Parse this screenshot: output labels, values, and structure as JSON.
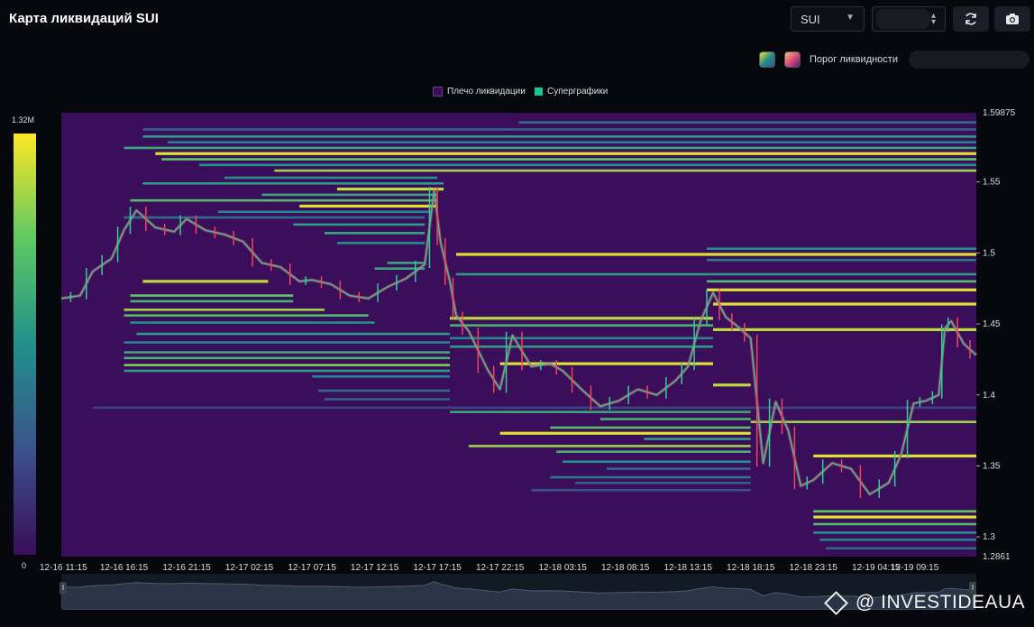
{
  "header": {
    "title": "Карта ликвидаций SUI",
    "symbol_select": "SUI",
    "range_select": "",
    "refresh_icon": "refresh-icon",
    "screenshot_icon": "camera-icon"
  },
  "threshold": {
    "label": "Порог ликвидности",
    "swatch_colors": [
      "#21918c",
      "#d94f7a"
    ]
  },
  "legend": {
    "items": [
      {
        "label": "Плечо ликвидации",
        "color": "#3a0e5a"
      },
      {
        "label": "Суперграфики",
        "color": "#18c88a"
      }
    ]
  },
  "colorbar": {
    "max_label": "1.32M",
    "min_label": "0",
    "colors": [
      "#3a0e5a",
      "#3b528b",
      "#21918c",
      "#5ec962",
      "#fde725"
    ]
  },
  "watermark": "@ INVESTIDEAUA",
  "chart_data": {
    "type": "heatmap",
    "title": "",
    "x_ticks": [
      "12-16 11:15",
      "12-16 16:15",
      "12-16 21:15",
      "12-17 02:15",
      "12-17 07:15",
      "12-17 12:15",
      "12-17 17:15",
      "12-17 22:15",
      "12-18 03:15",
      "12-18 08:15",
      "12-18 13:15",
      "12-18 18:15",
      "12-18 23:15",
      "12-19 04:15",
      "12-19 09:15"
    ],
    "y_ticks": [
      1.3,
      1.35,
      1.4,
      1.45,
      1.5,
      1.55
    ],
    "y_top_label": "1.59875",
    "y_bottom_label": "1.2861",
    "ylim": [
      1.2861,
      1.59875
    ],
    "xlim": [
      0,
      14.6
    ],
    "background_color": "#3a0e5a",
    "bands": [
      {
        "y": 1.592,
        "x0": 7.3,
        "x1": 14.6,
        "v": 0.35
      },
      {
        "y": 1.587,
        "x0": 1.3,
        "x1": 14.6,
        "v": 0.3
      },
      {
        "y": 1.582,
        "x0": 1.3,
        "x1": 14.6,
        "v": 0.55
      },
      {
        "y": 1.578,
        "x0": 1.7,
        "x1": 14.6,
        "v": 0.45
      },
      {
        "y": 1.574,
        "x0": 1.0,
        "x1": 14.6,
        "v": 0.6
      },
      {
        "y": 1.57,
        "x0": 1.5,
        "x1": 14.6,
        "v": 0.95
      },
      {
        "y": 1.566,
        "x0": 1.6,
        "x1": 14.6,
        "v": 0.75
      },
      {
        "y": 1.562,
        "x0": 2.2,
        "x1": 14.6,
        "v": 0.5
      },
      {
        "y": 1.558,
        "x0": 3.4,
        "x1": 14.6,
        "v": 0.85
      },
      {
        "y": 1.553,
        "x0": 2.6,
        "x1": 6.0,
        "v": 0.5
      },
      {
        "y": 1.549,
        "x0": 1.3,
        "x1": 6.1,
        "v": 0.55
      },
      {
        "y": 1.545,
        "x0": 4.4,
        "x1": 6.1,
        "v": 0.9
      },
      {
        "y": 1.541,
        "x0": 3.2,
        "x1": 6.0,
        "v": 0.6
      },
      {
        "y": 1.537,
        "x0": 1.1,
        "x1": 6.0,
        "v": 0.7
      },
      {
        "y": 1.533,
        "x0": 3.8,
        "x1": 6.0,
        "v": 0.95
      },
      {
        "y": 1.529,
        "x0": 2.5,
        "x1": 5.9,
        "v": 0.45
      },
      {
        "y": 1.525,
        "x0": 1.0,
        "x1": 5.8,
        "v": 0.35
      },
      {
        "y": 1.52,
        "x0": 3.7,
        "x1": 5.8,
        "v": 0.55
      },
      {
        "y": 1.514,
        "x0": 4.2,
        "x1": 5.8,
        "v": 0.6
      },
      {
        "y": 1.507,
        "x0": 4.4,
        "x1": 5.8,
        "v": 0.5
      },
      {
        "y": 1.503,
        "x0": 10.3,
        "x1": 14.6,
        "v": 0.5
      },
      {
        "y": 1.499,
        "x0": 6.3,
        "x1": 14.6,
        "v": 0.95
      },
      {
        "y": 1.495,
        "x0": 10.3,
        "x1": 14.6,
        "v": 0.4
      },
      {
        "y": 1.493,
        "x0": 5.2,
        "x1": 5.8,
        "v": 0.6
      },
      {
        "y": 1.489,
        "x0": 5.0,
        "x1": 5.8,
        "v": 0.6
      },
      {
        "y": 1.485,
        "x0": 6.3,
        "x1": 14.6,
        "v": 0.55
      },
      {
        "y": 1.48,
        "x0": 1.3,
        "x1": 3.3,
        "v": 0.9
      },
      {
        "y": 1.48,
        "x0": 10.3,
        "x1": 14.6,
        "v": 0.7
      },
      {
        "y": 1.474,
        "x0": 10.3,
        "x1": 14.6,
        "v": 0.95
      },
      {
        "y": 1.47,
        "x0": 1.1,
        "x1": 3.7,
        "v": 0.75
      },
      {
        "y": 1.466,
        "x0": 1.1,
        "x1": 3.7,
        "v": 0.65
      },
      {
        "y": 1.464,
        "x0": 10.4,
        "x1": 14.6,
        "v": 0.95
      },
      {
        "y": 1.46,
        "x0": 1.0,
        "x1": 4.2,
        "v": 0.85
      },
      {
        "y": 1.456,
        "x0": 1.0,
        "x1": 4.9,
        "v": 0.7
      },
      {
        "y": 1.454,
        "x0": 6.2,
        "x1": 10.4,
        "v": 0.9
      },
      {
        "y": 1.451,
        "x0": 1.1,
        "x1": 5.0,
        "v": 0.5
      },
      {
        "y": 1.449,
        "x0": 6.2,
        "x1": 10.4,
        "v": 0.65
      },
      {
        "y": 1.446,
        "x0": 10.4,
        "x1": 14.6,
        "v": 0.9
      },
      {
        "y": 1.443,
        "x0": 1.2,
        "x1": 6.2,
        "v": 0.55
      },
      {
        "y": 1.44,
        "x0": 6.2,
        "x1": 10.4,
        "v": 0.45
      },
      {
        "y": 1.437,
        "x0": 1.0,
        "x1": 6.2,
        "v": 0.45
      },
      {
        "y": 1.434,
        "x0": 6.2,
        "x1": 10.4,
        "v": 0.55
      },
      {
        "y": 1.43,
        "x0": 1.0,
        "x1": 6.2,
        "v": 0.6
      },
      {
        "y": 1.426,
        "x0": 1.0,
        "x1": 6.2,
        "v": 0.65
      },
      {
        "y": 1.422,
        "x0": 7.0,
        "x1": 10.4,
        "v": 0.95
      },
      {
        "y": 1.421,
        "x0": 1.0,
        "x1": 6.2,
        "v": 0.8
      },
      {
        "y": 1.417,
        "x0": 1.0,
        "x1": 6.2,
        "v": 0.55
      },
      {
        "y": 1.413,
        "x0": 4.0,
        "x1": 6.2,
        "v": 0.45
      },
      {
        "y": 1.407,
        "x0": 10.4,
        "x1": 11.0,
        "v": 0.9
      },
      {
        "y": 1.403,
        "x0": 4.1,
        "x1": 6.2,
        "v": 0.35
      },
      {
        "y": 1.397,
        "x0": 4.2,
        "x1": 6.2,
        "v": 0.3
      },
      {
        "y": 1.391,
        "x0": 0.5,
        "x1": 14.6,
        "v": 0.2
      },
      {
        "y": 1.388,
        "x0": 6.2,
        "x1": 11.0,
        "v": 0.6
      },
      {
        "y": 1.383,
        "x0": 8.6,
        "x1": 11.0,
        "v": 0.65
      },
      {
        "y": 1.381,
        "x0": 11.0,
        "x1": 14.6,
        "v": 0.85
      },
      {
        "y": 1.377,
        "x0": 7.8,
        "x1": 11.0,
        "v": 0.7
      },
      {
        "y": 1.373,
        "x0": 7.0,
        "x1": 11.0,
        "v": 0.95
      },
      {
        "y": 1.369,
        "x0": 9.3,
        "x1": 11.0,
        "v": 0.55
      },
      {
        "y": 1.364,
        "x0": 6.5,
        "x1": 11.0,
        "v": 0.85
      },
      {
        "y": 1.36,
        "x0": 7.9,
        "x1": 11.0,
        "v": 0.65
      },
      {
        "y": 1.357,
        "x0": 12.0,
        "x1": 14.6,
        "v": 0.95
      },
      {
        "y": 1.353,
        "x0": 8.0,
        "x1": 11.0,
        "v": 0.5
      },
      {
        "y": 1.348,
        "x0": 8.7,
        "x1": 11.0,
        "v": 0.35
      },
      {
        "y": 1.342,
        "x0": 7.8,
        "x1": 11.0,
        "v": 0.4
      },
      {
        "y": 1.338,
        "x0": 8.2,
        "x1": 11.0,
        "v": 0.3
      },
      {
        "y": 1.333,
        "x0": 7.5,
        "x1": 11.0,
        "v": 0.25
      },
      {
        "y": 1.318,
        "x0": 12.0,
        "x1": 14.6,
        "v": 0.75
      },
      {
        "y": 1.314,
        "x0": 12.0,
        "x1": 14.6,
        "v": 0.95
      },
      {
        "y": 1.309,
        "x0": 12.0,
        "x1": 14.6,
        "v": 0.7
      },
      {
        "y": 1.303,
        "x0": 12.0,
        "x1": 14.6,
        "v": 0.5
      },
      {
        "y": 1.298,
        "x0": 12.1,
        "x1": 14.6,
        "v": 0.45
      },
      {
        "y": 1.292,
        "x0": 12.2,
        "x1": 14.6,
        "v": 0.35
      }
    ],
    "price": {
      "x": [
        0.0,
        0.3,
        0.5,
        0.8,
        1.0,
        1.2,
        1.5,
        1.8,
        2.0,
        2.3,
        2.6,
        2.9,
        3.2,
        3.5,
        3.8,
        4.0,
        4.3,
        4.6,
        4.9,
        5.2,
        5.5,
        5.8,
        5.95,
        6.05,
        6.2,
        6.3,
        6.5,
        6.8,
        7.0,
        7.2,
        7.5,
        7.8,
        8.0,
        8.3,
        8.6,
        8.9,
        9.2,
        9.5,
        9.8,
        10.0,
        10.2,
        10.4,
        10.6,
        10.8,
        11.0,
        11.2,
        11.4,
        11.6,
        11.8,
        12.0,
        12.3,
        12.6,
        12.9,
        13.2,
        13.4,
        13.6,
        13.8,
        14.0,
        14.1,
        14.2,
        14.4,
        14.6
      ],
      "y": [
        1.468,
        1.47,
        1.487,
        1.496,
        1.516,
        1.53,
        1.518,
        1.515,
        1.524,
        1.516,
        1.513,
        1.508,
        1.493,
        1.49,
        1.48,
        1.481,
        1.478,
        1.47,
        1.468,
        1.476,
        1.482,
        1.492,
        1.544,
        1.508,
        1.48,
        1.456,
        1.445,
        1.418,
        1.404,
        1.442,
        1.42,
        1.422,
        1.417,
        1.404,
        1.392,
        1.396,
        1.404,
        1.4,
        1.41,
        1.42,
        1.452,
        1.472,
        1.455,
        1.448,
        1.44,
        1.352,
        1.395,
        1.375,
        1.336,
        1.34,
        1.352,
        1.348,
        1.33,
        1.338,
        1.358,
        1.394,
        1.396,
        1.4,
        1.447,
        1.452,
        1.436,
        1.428
      ]
    }
  }
}
